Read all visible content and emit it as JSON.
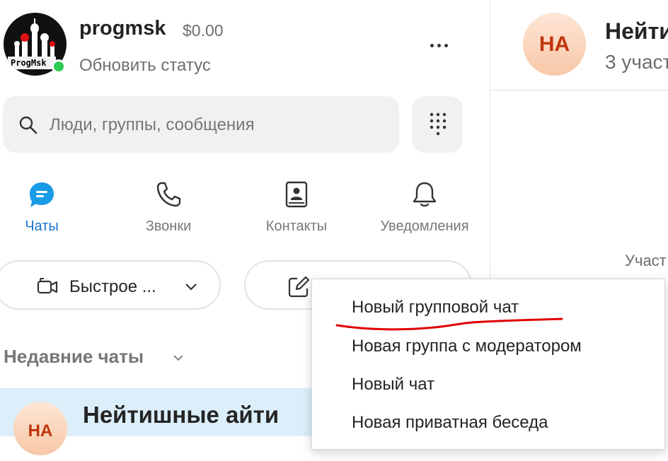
{
  "profile": {
    "username": "progmsk",
    "balance": "$0.00",
    "status_link": "Обновить статус",
    "avatar_logo_text": "ProgMsk",
    "presence_color": "#2ecc52"
  },
  "search": {
    "placeholder": "Люди, группы, сообщения"
  },
  "tabs": [
    {
      "label": "Чаты",
      "icon": "chat-bubble-icon",
      "active": true
    },
    {
      "label": "Звонки",
      "icon": "phone-icon",
      "active": false
    },
    {
      "label": "Контакты",
      "icon": "contacts-book-icon",
      "active": false
    },
    {
      "label": "Уведомления",
      "icon": "bell-icon",
      "active": false
    }
  ],
  "actions": {
    "quick_label": "Быстрое ...",
    "new_label": "Новый чат"
  },
  "recent": {
    "title": "Недавние чаты",
    "chats": [
      {
        "initials": "НА",
        "name": "Нейтишные айти"
      }
    ]
  },
  "menu": {
    "items": [
      "Новый групповой чат",
      "Новая группа с модератором",
      "Новый чат",
      "Новая приватная беседа"
    ],
    "annotation_color": "#e00000"
  },
  "conversation": {
    "initials": "НА",
    "title": "Нейти",
    "subtitle": "3 участ",
    "participants_label": "Участ"
  },
  "colors": {
    "accent": "#1a73c9",
    "selected_row": "#dbeefa"
  }
}
